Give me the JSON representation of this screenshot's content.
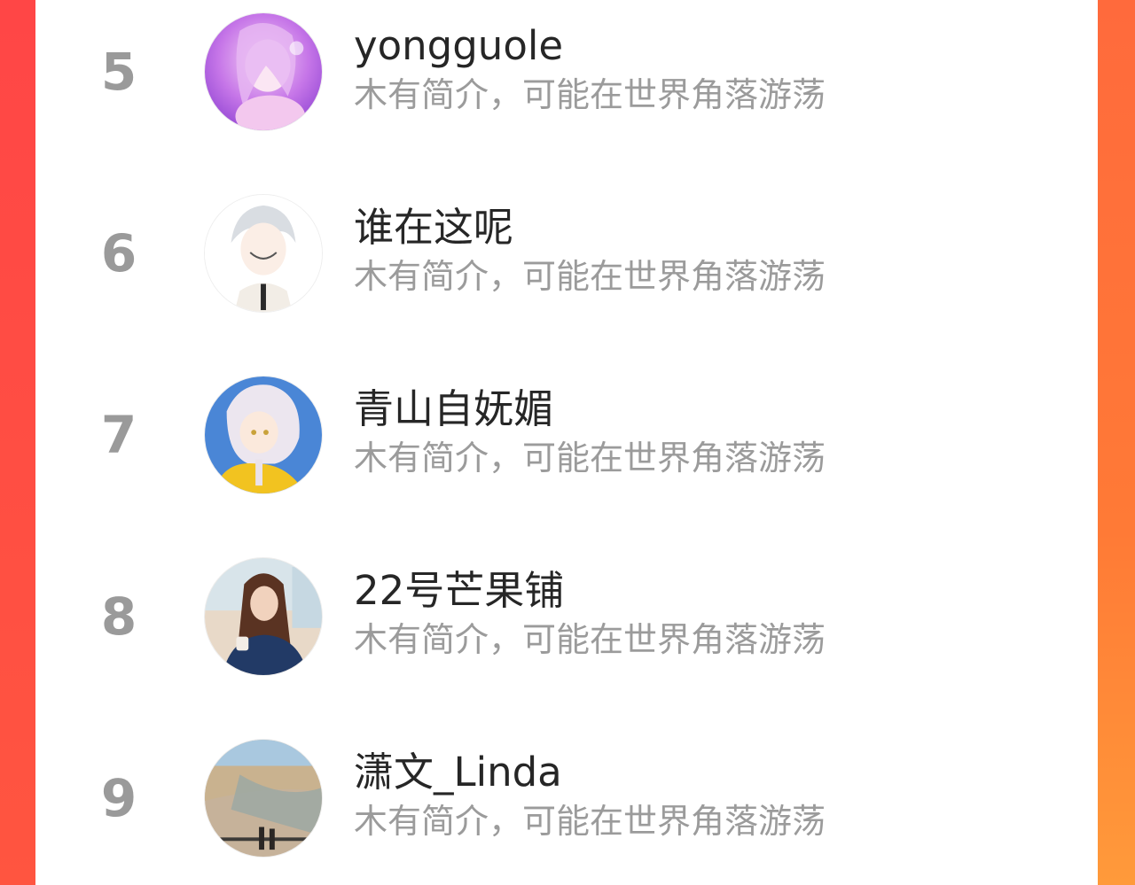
{
  "ranking": {
    "items": [
      {
        "rank": "5",
        "name": "yongguole",
        "bio": "木有简介，可能在世界角落游荡",
        "avatar": "anime-girl-purple-avatar"
      },
      {
        "rank": "6",
        "name": "谁在这呢",
        "bio": "木有简介，可能在世界角落游荡",
        "avatar": "anime-boy-white-hair-avatar"
      },
      {
        "rank": "7",
        "name": "青山自妩媚",
        "bio": "木有简介，可能在世界角落游荡",
        "avatar": "anime-girl-yellow-avatar"
      },
      {
        "rank": "8",
        "name": "22号芒果铺",
        "bio": "木有简介，可能在世界角落游荡",
        "avatar": "photo-woman-avatar"
      },
      {
        "rank": "9",
        "name": "潇文_Linda",
        "bio": "木有简介，可能在世界角落游荡",
        "avatar": "beach-photo-avatar"
      }
    ]
  },
  "colors": {
    "background_accent": "#ff5a42",
    "rank_text": "#9a9a9a",
    "name_text": "#262626",
    "bio_text": "#9b9b9b"
  }
}
